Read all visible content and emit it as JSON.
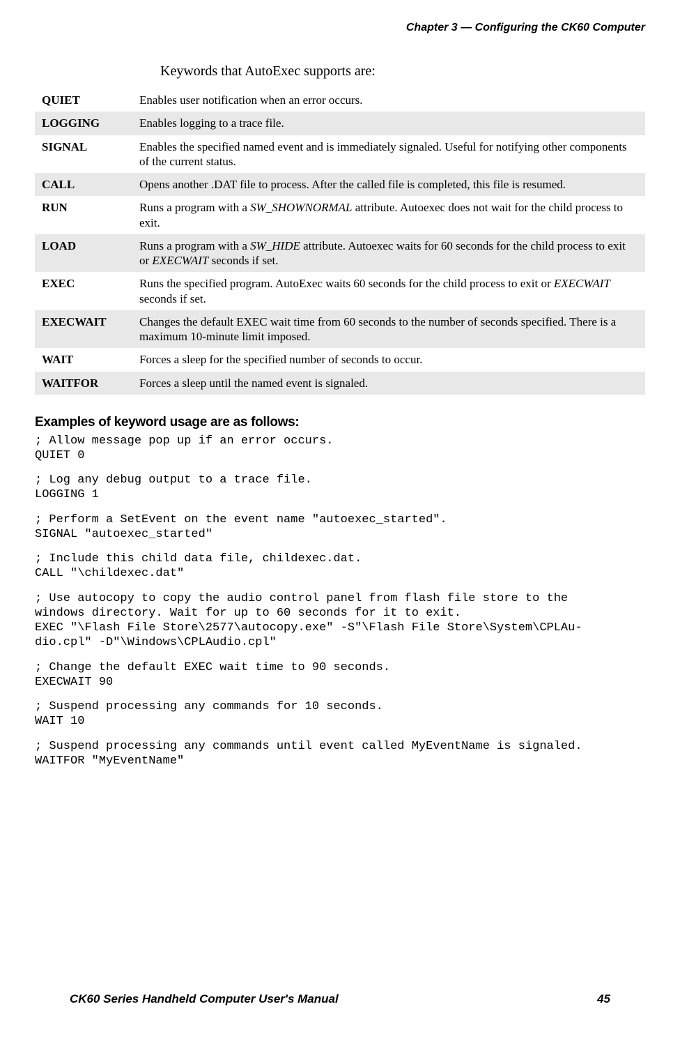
{
  "header": {
    "chapter": "Chapter 3 —  Configuring the CK60 Computer"
  },
  "intro": "Keywords that AutoExec supports are:",
  "keywords": [
    {
      "kw": "QUIET",
      "desc_segments": [
        {
          "t": "Enables user notification when an error occurs."
        }
      ]
    },
    {
      "kw": "LOGGING",
      "desc_segments": [
        {
          "t": "Enables logging to a trace file."
        }
      ]
    },
    {
      "kw": "SIGNAL",
      "desc_segments": [
        {
          "t": "Enables the specified named event and is immediately signaled. Useful for notifying other components of the current status."
        }
      ]
    },
    {
      "kw": "CALL",
      "desc_segments": [
        {
          "t": "Opens another .DAT file to process. After the called file is completed, this file is resumed."
        }
      ]
    },
    {
      "kw": "RUN",
      "desc_segments": [
        {
          "t": "Runs a program with a "
        },
        {
          "t": "SW_SHOWNORMAL",
          "italic": true
        },
        {
          "t": " attribute. Autoexec does not wait for the child process to exit."
        }
      ]
    },
    {
      "kw": "LOAD",
      "desc_segments": [
        {
          "t": "Runs a program with a "
        },
        {
          "t": "SW_HIDE",
          "italic": true
        },
        {
          "t": " attribute. Autoexec waits for 60 seconds for the child process to exit or "
        },
        {
          "t": "EXECWAIT",
          "italic": true
        },
        {
          "t": " seconds if set."
        }
      ]
    },
    {
      "kw": "EXEC",
      "desc_segments": [
        {
          "t": "Runs the specified program. AutoExec waits 60 seconds for the child process to exit or "
        },
        {
          "t": "EXECWAIT",
          "italic": true
        },
        {
          "t": " seconds if set."
        }
      ]
    },
    {
      "kw": "EXECWAIT",
      "desc_segments": [
        {
          "t": "Changes the default EXEC wait time from 60 seconds to the number of seconds specified. There is a maximum 10-minute limit imposed."
        }
      ]
    },
    {
      "kw": "WAIT",
      "desc_segments": [
        {
          "t": "Forces a sleep for the specified number of seconds to occur."
        }
      ]
    },
    {
      "kw": "WAITFOR",
      "desc_segments": [
        {
          "t": "Forces a sleep until the named event is signaled."
        }
      ]
    }
  ],
  "examples_heading": "Examples of keyword usage are as follows:",
  "code_blocks": [
    "; Allow message pop up if an error occurs.\nQUIET 0",
    "; Log any debug output to a trace file.\nLOGGING 1",
    "; Perform a SetEvent on the event name \"autoexec_started\".\nSIGNAL \"autoexec_started\"",
    "; Include this child data file, childexec.dat.\nCALL \"\\childexec.dat\"",
    "; Use autocopy to copy the audio control panel from flash file store to the\nwindows directory. Wait for up to 60 seconds for it to exit.\nEXEC \"\\Flash File Store\\2577\\autocopy.exe\" -S\"\\Flash File Store\\System\\CPLAu-\ndio.cpl\" -D\"\\Windows\\CPLAudio.cpl\"",
    "; Change the default EXEC wait time to 90 seconds.\nEXECWAIT 90",
    "; Suspend processing any commands for 10 seconds.\nWAIT 10",
    "; Suspend processing any commands until event called MyEventName is signaled.\nWAITFOR \"MyEventName\""
  ],
  "footer": {
    "left": "CK60 Series Handheld Computer User's Manual",
    "right": "45"
  }
}
